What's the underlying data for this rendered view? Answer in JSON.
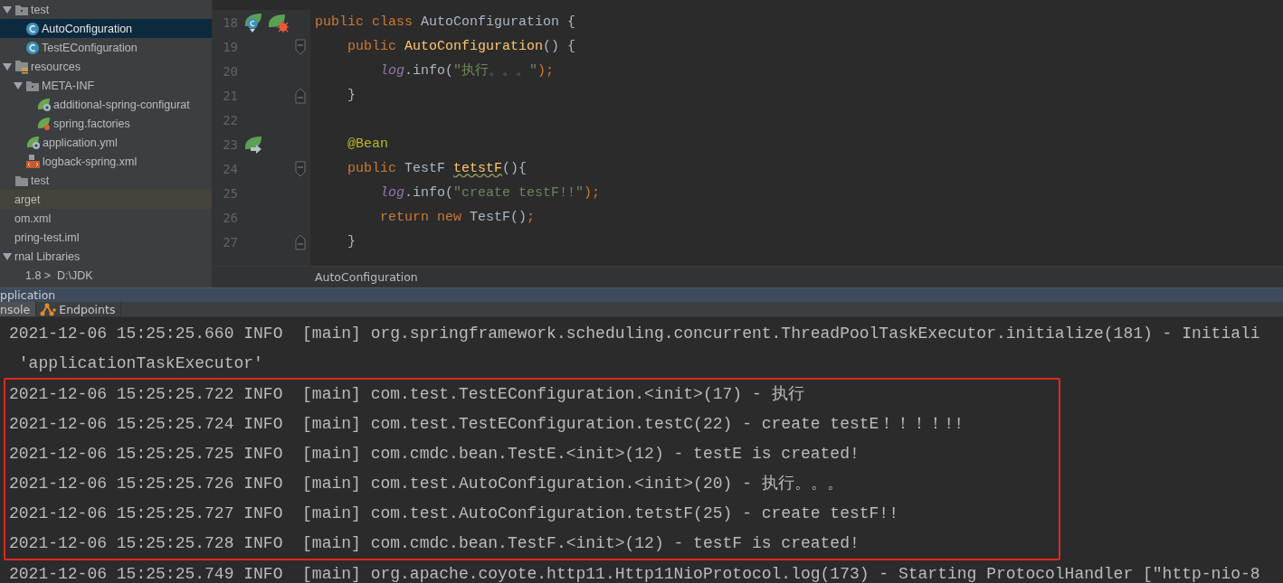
{
  "project_tree": [
    {
      "label": "test",
      "kind": "package",
      "expanded": true,
      "selected": false,
      "children": [
        {
          "label": "AutoConfiguration",
          "kind": "class",
          "selected": true
        },
        {
          "label": "TestEConfiguration",
          "kind": "class",
          "selected": false
        }
      ]
    },
    {
      "label": "resources",
      "kind": "resources",
      "expanded": true,
      "selected": false,
      "children": [
        {
          "label": "META-INF",
          "kind": "package",
          "expanded": true,
          "selected": false,
          "children": [
            {
              "label": "additional-spring-configurat",
              "kind": "spring-config",
              "selected": false
            },
            {
              "label": "spring.factories",
              "kind": "spring-factories",
              "selected": false
            }
          ]
        },
        {
          "label": "application.yml",
          "kind": "spring-config",
          "selected": false
        },
        {
          "label": "logback-spring.xml",
          "kind": "xml",
          "selected": false
        }
      ]
    },
    {
      "label": "test",
      "kind": "folder",
      "selected": false
    },
    {
      "label": "arget",
      "kind": "excluded",
      "selected": false
    },
    {
      "label": "om.xml",
      "kind": "plain",
      "selected": false
    },
    {
      "label": "pring-test.iml",
      "kind": "plain",
      "selected": false
    },
    {
      "label": "rnal Libraries",
      "kind": "plain",
      "expanded": true,
      "selected": false,
      "children": [
        {
          "label": "1.8 >  D:\\JDK",
          "kind": "sdk",
          "selected": false
        }
      ]
    }
  ],
  "editor": {
    "lines": [
      {
        "number": "18",
        "gutter_icons": [
          {
            "kind": "leaf-class"
          },
          {
            "kind": "leaf-burst"
          }
        ],
        "tokens": [
          {
            "text": "public class ",
            "kind": "keyword"
          },
          {
            "text": "AutoConfiguration {",
            "kind": "plain"
          }
        ]
      },
      {
        "number": "19",
        "fold_marker": {
          "kind": "start"
        },
        "tokens": [
          {
            "text": "    public ",
            "kind": "keyword"
          },
          {
            "text": "AutoConfiguration",
            "kind": "method"
          },
          {
            "text": "() {",
            "kind": "plain"
          }
        ]
      },
      {
        "number": "20",
        "tokens": [
          {
            "text": "        log",
            "kind": "field"
          },
          {
            "text": ".info(",
            "kind": "plain"
          },
          {
            "text": "\"执行。。。\"",
            "kind": "string"
          },
          {
            "text": ");",
            "kind": "keyword"
          }
        ]
      },
      {
        "number": "21",
        "fold_marker": {
          "kind": "end"
        },
        "tokens": [
          {
            "text": "    }",
            "kind": "plain"
          }
        ]
      },
      {
        "number": "22"
      },
      {
        "number": "23",
        "gutter_icons": [
          {
            "kind": "leaf-arrow"
          }
        ],
        "tokens": [
          {
            "text": "    @Bean",
            "kind": "annotation"
          }
        ]
      },
      {
        "number": "24",
        "fold_marker": {
          "kind": "start"
        },
        "tokens": [
          {
            "text": "    public ",
            "kind": "keyword"
          },
          {
            "text": "TestF ",
            "kind": "plain"
          },
          {
            "text": "tetstF",
            "kind": "method-warning"
          },
          {
            "text": "(){",
            "kind": "plain"
          }
        ]
      },
      {
        "number": "25",
        "tokens": [
          {
            "text": "        log",
            "kind": "field"
          },
          {
            "text": ".info(",
            "kind": "plain"
          },
          {
            "text": "\"create testF!!\"",
            "kind": "string"
          },
          {
            "text": ");",
            "kind": "keyword"
          }
        ]
      },
      {
        "number": "26",
        "tokens": [
          {
            "text": "        return new ",
            "kind": "keyword"
          },
          {
            "text": "TestF()",
            "kind": "plain"
          },
          {
            "text": ";",
            "kind": "keyword"
          }
        ]
      },
      {
        "number": "27",
        "fold_marker": {
          "kind": "end"
        },
        "tokens": [
          {
            "text": "    }",
            "kind": "plain"
          }
        ]
      }
    ],
    "breadcrumb": "AutoConfiguration"
  },
  "run_panel": {
    "title": "pplication",
    "tabs": [
      {
        "label": "nsole",
        "selected": true
      },
      {
        "label": "Endpoints",
        "selected": false,
        "kind": "endpoints"
      }
    ],
    "lines": [
      {
        "text": "2021-12-06 15:25:25.660 INFO  [main] org.springframework.scheduling.concurrent.ThreadPoolTaskExecutor.initialize(181) - Initiali",
        "highlighted": false
      },
      {
        "text": " 'applicationTaskExecutor'",
        "highlighted": false
      },
      {
        "text": "2021-12-06 15:25:25.722 INFO  [main] com.test.TestEConfiguration.<init>(17) - 执行",
        "highlighted": true
      },
      {
        "text": "2021-12-06 15:25:25.724 INFO  [main] com.test.TestEConfiguration.testC(22) - create testE！！！！!!",
        "highlighted": true
      },
      {
        "text": "2021-12-06 15:25:25.725 INFO  [main] com.cmdc.bean.TestE.<init>(12) - testE is created!",
        "highlighted": true
      },
      {
        "text": "2021-12-06 15:25:25.726 INFO  [main] com.test.AutoConfiguration.<init>(20) - 执行。。。",
        "highlighted": true
      },
      {
        "text": "2021-12-06 15:25:25.727 INFO  [main] com.test.AutoConfiguration.tetstF(25) - create testF!!",
        "highlighted": true
      },
      {
        "text": "2021-12-06 15:25:25.728 INFO  [main] com.cmdc.bean.TestF.<init>(12) - testF is created!",
        "highlighted": true
      },
      {
        "text": "2021-12-06 15:25:25.749 INFO  [main] org.apache.coyote.http11.Http11NioProtocol.log(173) - Starting ProtocolHandler [\"http-nio-8",
        "highlighted": false
      }
    ]
  }
}
